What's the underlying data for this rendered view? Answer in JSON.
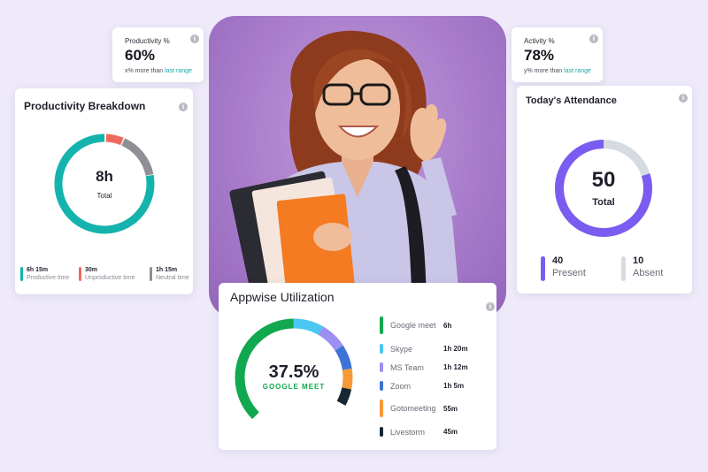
{
  "productivity_stat": {
    "title": "Productivity %",
    "value": "60%",
    "note_prefix": "x% more than ",
    "note_link": "last range"
  },
  "activity_stat": {
    "title": "Activity %",
    "value": "78%",
    "note_prefix": "y% more than ",
    "note_link": "last range"
  },
  "productivity_breakdown": {
    "title": "Productivity Breakdown",
    "center_value": "8h",
    "center_label": "Total",
    "legend": [
      {
        "value": "6h 15m",
        "label": "Productive time",
        "color": "#14b3ad"
      },
      {
        "value": "30m",
        "label": "Unproductive time",
        "color": "#ef6a5e"
      },
      {
        "value": "1h 15m",
        "label": "Neutral time",
        "color": "#8f8f96"
      }
    ]
  },
  "attendance": {
    "title": "Today's Attendance",
    "center_value": "50",
    "center_label": "Total",
    "present": {
      "value": "40",
      "label": "Present",
      "color": "#7b5cf0"
    },
    "absent": {
      "value": "10",
      "label": "Absent",
      "color": "#d6dbe2"
    }
  },
  "utilization": {
    "title": "Appwise Utilization",
    "center_value": "37.5%",
    "center_label": "GOOGLE MEET",
    "center_label_color": "#12a84f",
    "apps": [
      {
        "name": "Google meet",
        "value": "6h",
        "color": "#12a84f"
      },
      {
        "name": "Skype",
        "value": "1h 20m",
        "color": "#4ac7f3"
      },
      {
        "name": "MS Team",
        "value": "1h 12m",
        "color": "#9b8ff0"
      },
      {
        "name": "Zoom",
        "value": "1h 5m",
        "color": "#3e73d6"
      },
      {
        "name": "Gotomeeting",
        "value": "55m",
        "color": "#f59a36"
      },
      {
        "name": "Livestorm",
        "value": "45m",
        "color": "#172732"
      }
    ]
  },
  "colors": {
    "background": "#eeeaf9",
    "photo_background": "#a97dcb",
    "accent_teal": "#17a5a2"
  }
}
